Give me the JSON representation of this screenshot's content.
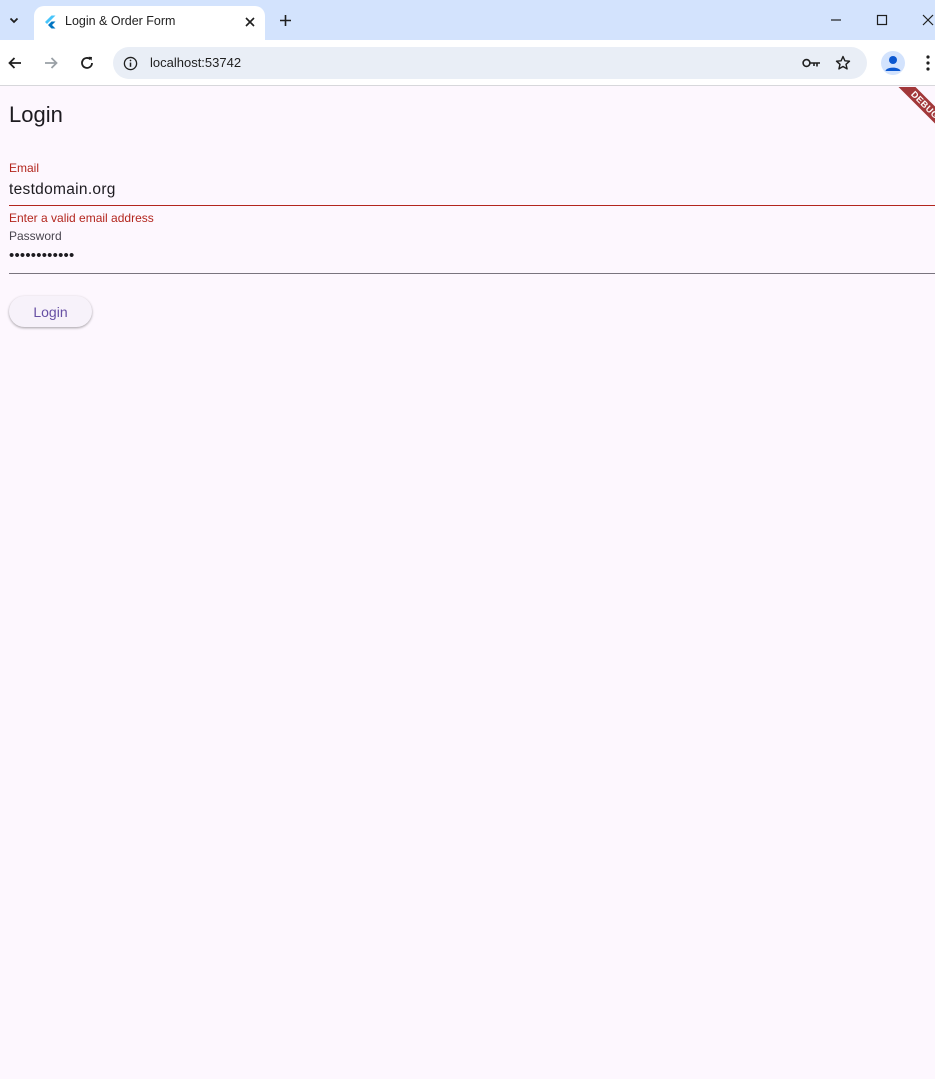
{
  "browser": {
    "tab_title": "Login & Order Form",
    "url": "localhost:53742"
  },
  "icons": {
    "tab_search": "chevron-down-icon",
    "favicon": "flutter-icon",
    "tab_close": "close-icon",
    "new_tab": "plus-icon",
    "minimize": "minimize-icon",
    "maximize": "maximize-icon",
    "window_close": "close-icon",
    "back": "arrow-left-icon",
    "forward": "arrow-right-icon",
    "reload": "reload-icon",
    "site_info": "info-icon",
    "passwords": "key-icon",
    "bookmark": "star-icon",
    "profile": "person-icon",
    "menu": "more-vertical-icon"
  },
  "app": {
    "title": "Login",
    "debug_banner": "DEBUG",
    "email": {
      "label": "Email",
      "value": "testdomain.org",
      "error": "Enter a valid email address"
    },
    "password": {
      "label": "Password",
      "value": "••••••••••••"
    },
    "login_button": "Login"
  },
  "colors": {
    "background": "#fdf7fe",
    "error": "#b3261e",
    "primary": "#6750a4",
    "tabstrip": "#d3e3fd",
    "debug_banner": "#a2383a"
  }
}
